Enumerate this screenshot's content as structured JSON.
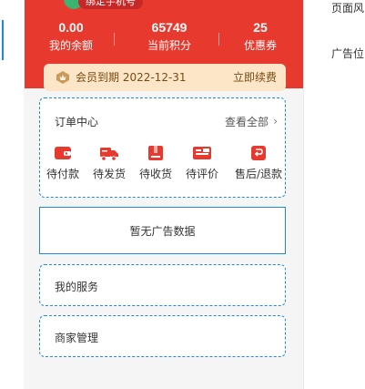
{
  "header": {
    "bind_phone_label": "绑定手机号",
    "stats": [
      {
        "value": "0.00",
        "label": "我的余额"
      },
      {
        "value": "65749",
        "label": "当前积分"
      },
      {
        "value": "25",
        "label": "优惠券"
      }
    ],
    "colors": {
      "brand_red": "#e8392e",
      "gold_bg": "#fde6c7",
      "gold_text": "#7a4a13"
    }
  },
  "member": {
    "expiry_label": "会员到期 2022-12-31",
    "renew_label": "立即续费"
  },
  "orders": {
    "title": "订单中心",
    "view_all": "查看全部",
    "items": [
      {
        "icon": "wallet-icon",
        "label": "待付款"
      },
      {
        "icon": "truck-icon",
        "label": "待发货"
      },
      {
        "icon": "box-icon",
        "label": "待收货"
      },
      {
        "icon": "review-icon",
        "label": "待评价"
      },
      {
        "icon": "refund-icon",
        "label": "售后/退款"
      }
    ]
  },
  "ad": {
    "empty_label": "暂无广告数据"
  },
  "service": {
    "label": "我的服务"
  },
  "merchant": {
    "label": "商家管理"
  },
  "side_panel": {
    "items": [
      "页面风",
      "广告位"
    ]
  },
  "accent": "#1e88e5"
}
